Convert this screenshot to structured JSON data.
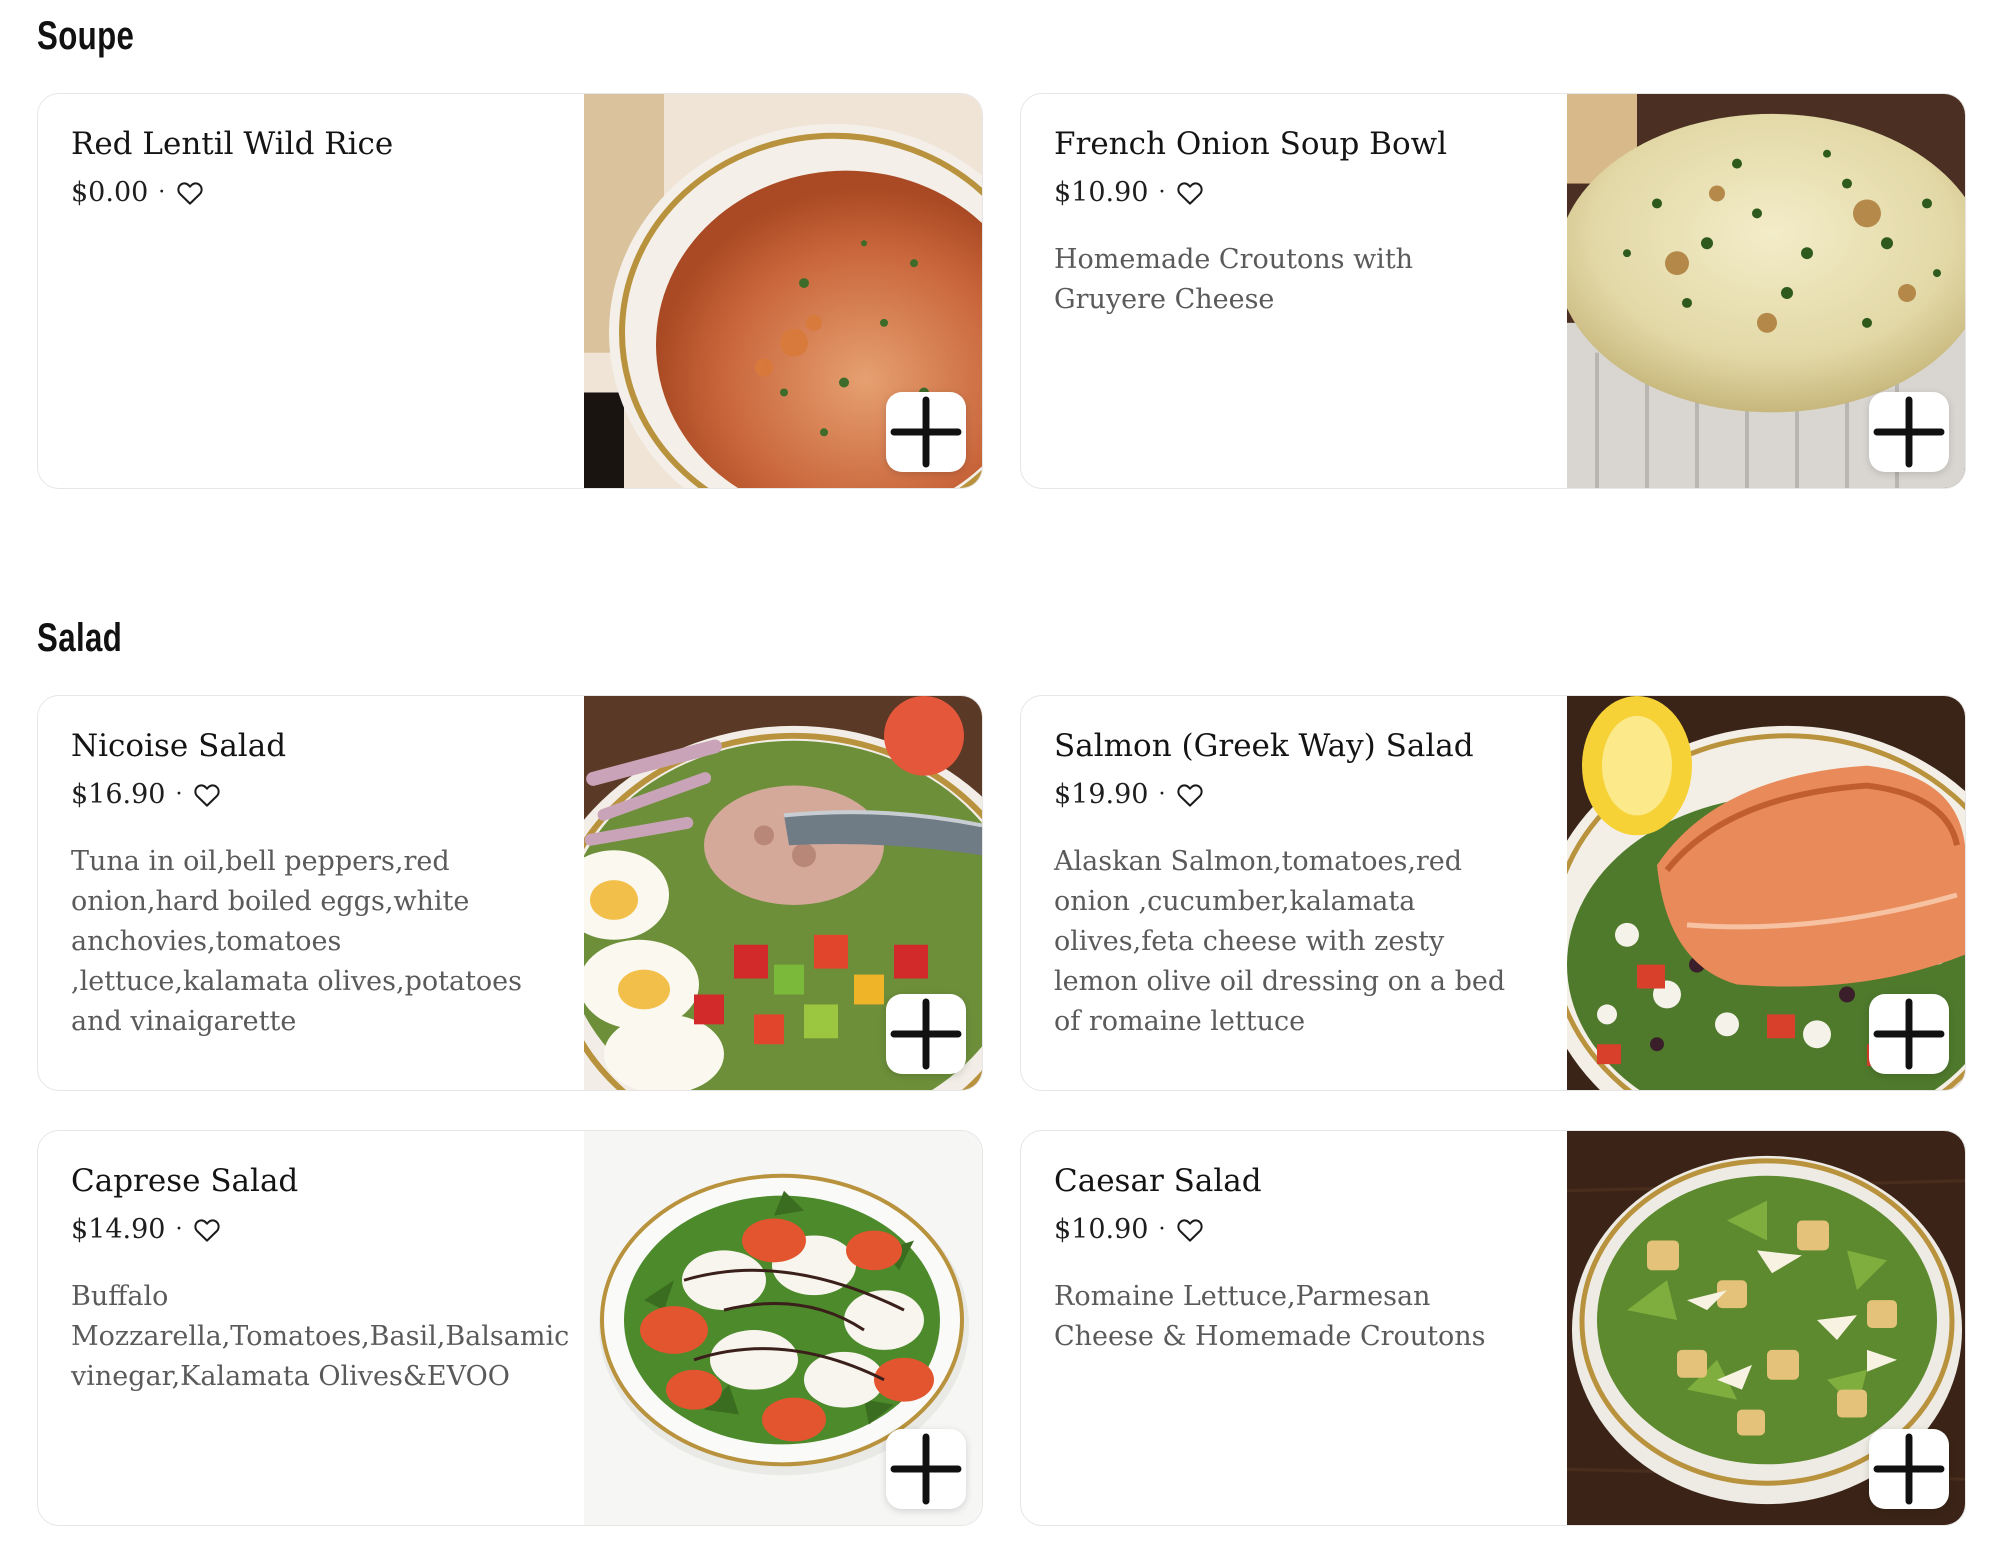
{
  "sections": [
    {
      "title": "Soupe",
      "items": [
        {
          "name": "Red Lentil Wild Rice",
          "price": "$0.00",
          "description": ""
        },
        {
          "name": "French Onion Soup Bowl",
          "price": "$10.90",
          "description": "Homemade Croutons with Gruyere Cheese"
        }
      ]
    },
    {
      "title": "Salad",
      "items": [
        {
          "name": "Nicoise Salad",
          "price": "$16.90",
          "description": "Tuna in oil,bell peppers,red onion,hard boiled eggs,white anchovies,tomatoes ,lettuce,kalamata olives,potatoes and vinaigarette"
        },
        {
          "name": "Salmon (Greek Way) Salad",
          "price": "$19.90",
          "description": "Alaskan Salmon,tomatoes,red onion ,cucumber,kalamata olives,feta cheese with zesty lemon olive oil dressing on a bed of romaine lettuce"
        },
        {
          "name": "Caprese Salad",
          "price": "$14.90",
          "description": "Buffalo Mozzarella,Tomatoes,Basil,Balsamic vinegar,Kalamata Olives&EVOO"
        },
        {
          "name": "Caesar Salad",
          "price": "$10.90",
          "description": "Romaine Lettuce,Parmesan Cheese & Homemade Croutons"
        }
      ]
    }
  ],
  "separator": "·",
  "icons": {
    "favorite": "heart-outline-icon",
    "add": "plus-icon"
  },
  "colors": {
    "text": "#141414",
    "description": "#5a5a5a",
    "card_border": "#e6e6e6"
  }
}
